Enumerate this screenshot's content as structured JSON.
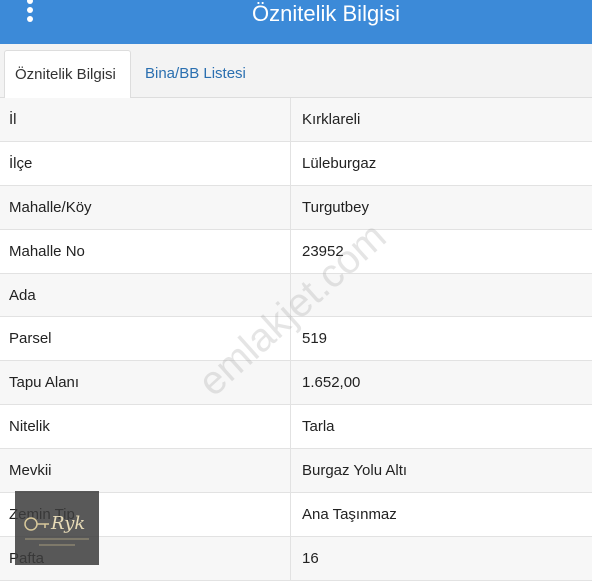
{
  "header": {
    "title": "Öznitelik Bilgisi",
    "color": "#3c8ad8",
    "menu_icon": "vertical-ellipsis-icon"
  },
  "tabs": [
    {
      "label": "Öznitelik Bilgisi",
      "active": true
    },
    {
      "label": "Bina/BB Listesi",
      "active": false
    }
  ],
  "rows": [
    {
      "label": "İl",
      "value": "Kırklareli"
    },
    {
      "label": "İlçe",
      "value": "Lüleburgaz"
    },
    {
      "label": "Mahalle/Köy",
      "value": "Turgutbey"
    },
    {
      "label": "Mahalle No",
      "value": "23952"
    },
    {
      "label": "Ada",
      "value": ""
    },
    {
      "label": "Parsel",
      "value": "519"
    },
    {
      "label": "Tapu Alanı",
      "value": "1.652,00"
    },
    {
      "label": "Nitelik",
      "value": "Tarla"
    },
    {
      "label": "Mevkii",
      "value": "Burgaz Yolu Altı"
    },
    {
      "label": "Zemin Tip",
      "value": "Ana Taşınmaz"
    },
    {
      "label": "Pafta",
      "value": "16"
    }
  ],
  "watermark": "emlakjet.com",
  "logo_text": "Ryk"
}
